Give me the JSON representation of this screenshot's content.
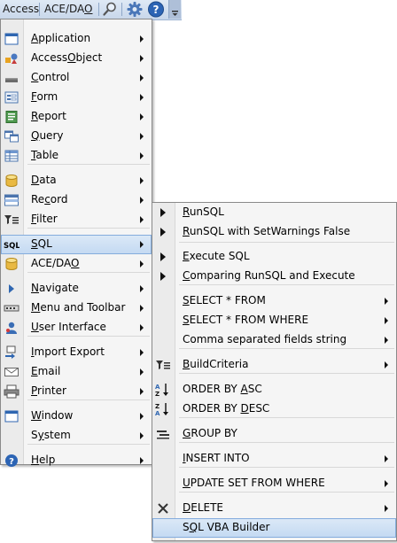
{
  "toolbar": {
    "access": {
      "pre": "Access",
      "u": "",
      "post": ""
    },
    "acedao": {
      "pre": "ACE/DA",
      "u": "O",
      "post": ""
    }
  },
  "main_menu": {
    "items": [
      {
        "pre": "",
        "u": "A",
        "post": "pplication",
        "icon": "window-icon",
        "submenu": true
      },
      {
        "pre": "Access",
        "u": "O",
        "post": "bject",
        "icon": "shapes-icon",
        "submenu": true
      },
      {
        "pre": "",
        "u": "C",
        "post": "ontrol",
        "icon": "control-icon",
        "submenu": true
      },
      {
        "pre": "",
        "u": "F",
        "post": "orm",
        "icon": "form-icon",
        "submenu": true
      },
      {
        "pre": "",
        "u": "R",
        "post": "eport",
        "icon": "report-icon",
        "submenu": true
      },
      {
        "pre": "",
        "u": "Q",
        "post": "uery",
        "icon": "query-icon",
        "submenu": true
      },
      {
        "pre": "",
        "u": "T",
        "post": "able",
        "icon": "table-icon",
        "submenu": true
      },
      {
        "pre": "",
        "u": "D",
        "post": "ata",
        "icon": "database-icon",
        "submenu": true
      },
      {
        "pre": "Re",
        "u": "c",
        "post": "ord",
        "icon": "record-icon",
        "submenu": true
      },
      {
        "pre": "",
        "u": "F",
        "post": "ilter",
        "icon": "filter-icon",
        "submenu": true
      },
      {
        "pre": "",
        "u": "S",
        "post": "QL",
        "icon": "sql-icon",
        "submenu": true,
        "highlight": true
      },
      {
        "pre": "ACE/DA",
        "u": "O",
        "post": "",
        "icon": "database-icon",
        "submenu": true
      },
      {
        "pre": "",
        "u": "N",
        "post": "avigate",
        "icon": "navigate-icon",
        "submenu": true
      },
      {
        "pre": "",
        "u": "M",
        "post": "enu and Toolbar",
        "icon": "menu-toolbar-icon",
        "submenu": true
      },
      {
        "pre": "",
        "u": "U",
        "post": "ser Interface",
        "icon": "user-icon",
        "submenu": true
      },
      {
        "pre": "",
        "u": "I",
        "post": "mport Export",
        "icon": "import-export-icon",
        "submenu": true
      },
      {
        "pre": "",
        "u": "E",
        "post": "mail",
        "icon": "email-icon",
        "submenu": true
      },
      {
        "pre": "",
        "u": "P",
        "post": "rinter",
        "icon": "printer-icon",
        "submenu": true
      },
      {
        "pre": "",
        "u": "W",
        "post": "indow",
        "icon": "window-icon",
        "submenu": true
      },
      {
        "pre": "S",
        "u": "y",
        "post": "stem",
        "icon": "",
        "submenu": true
      },
      {
        "pre": "",
        "u": "H",
        "post": "elp",
        "icon": "help-icon",
        "submenu": true
      }
    ]
  },
  "sql_menu": {
    "items": [
      {
        "pre": "",
        "u": "R",
        "post": "unSQL",
        "icon": "play-icon",
        "submenu": false
      },
      {
        "pre": "",
        "u": "R",
        "post": "unSQL with SetWarnings False",
        "icon": "play-icon",
        "submenu": false
      },
      {
        "pre": "",
        "u": "E",
        "post": "xecute SQL",
        "icon": "play-icon",
        "submenu": false
      },
      {
        "pre": "",
        "u": "C",
        "post": "omparing RunSQL and Execute",
        "icon": "play-icon",
        "submenu": false
      },
      {
        "pre": "",
        "u": "S",
        "post": "ELECT * FROM",
        "icon": "",
        "submenu": true
      },
      {
        "pre": "",
        "u": "S",
        "post": "ELECT * FROM WHERE",
        "icon": "",
        "submenu": true
      },
      {
        "pre": "Comma separated fields string",
        "u": "",
        "post": "",
        "icon": "",
        "submenu": true
      },
      {
        "pre": "",
        "u": "B",
        "post": "uildCriteria",
        "icon": "filter-icon",
        "submenu": true
      },
      {
        "pre": "ORDER BY ",
        "u": "A",
        "post": "SC",
        "icon": "sort-asc-icon",
        "submenu": false
      },
      {
        "pre": "ORDER BY ",
        "u": "D",
        "post": "ESC",
        "icon": "sort-desc-icon",
        "submenu": false
      },
      {
        "pre": "",
        "u": "G",
        "post": "ROUP BY",
        "icon": "group-icon",
        "submenu": false
      },
      {
        "pre": "",
        "u": "I",
        "post": "NSERT INTO",
        "icon": "",
        "submenu": true
      },
      {
        "pre": "",
        "u": "U",
        "post": "PDATE SET FROM WHERE",
        "icon": "",
        "submenu": true
      },
      {
        "pre": "",
        "u": "D",
        "post": "ELETE",
        "icon": "delete-icon",
        "submenu": true
      },
      {
        "pre": "S",
        "u": "Q",
        "post": "L VBA Builder",
        "icon": "",
        "submenu": false,
        "highlight": true
      }
    ]
  }
}
